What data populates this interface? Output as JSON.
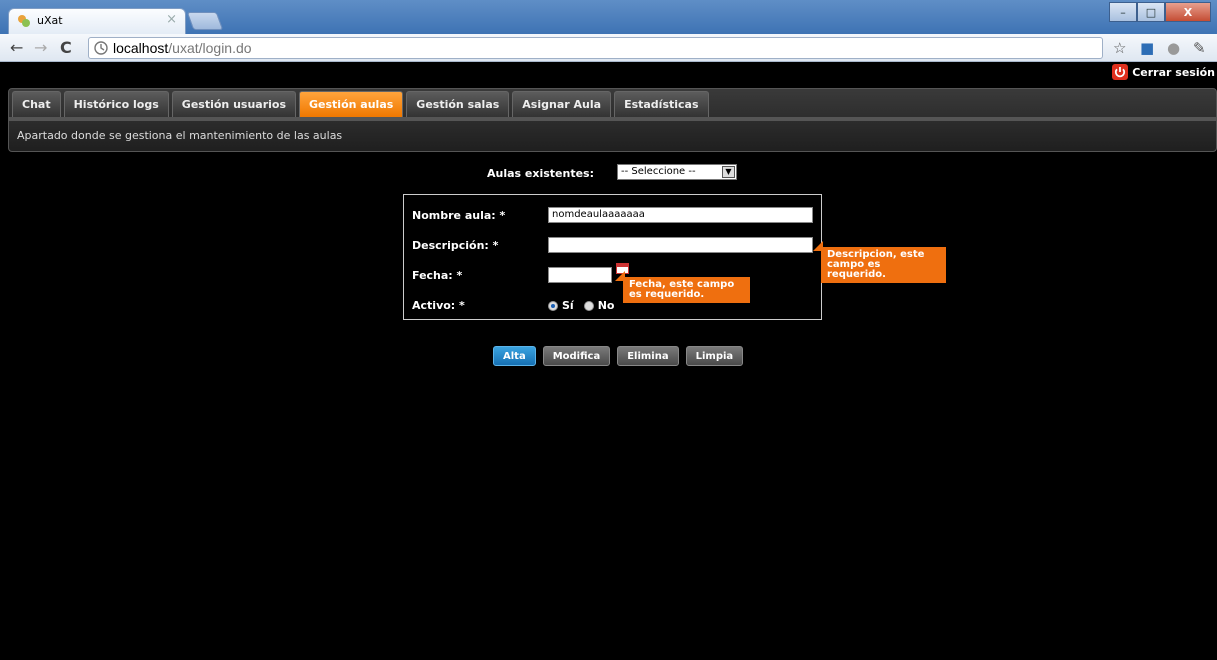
{
  "browser": {
    "tab_title": "uXat",
    "tab_close": "×",
    "url_host": "localhost",
    "url_path": "/uxat/login.do",
    "window_controls": [
      "–",
      "□",
      "X"
    ]
  },
  "header": {
    "logout_label": "Cerrar sesión"
  },
  "menu": {
    "tabs": [
      {
        "label": "Chat"
      },
      {
        "label": "Histórico logs"
      },
      {
        "label": "Gestión usuarios"
      },
      {
        "label": "Gestión aulas"
      },
      {
        "label": "Gestión salas"
      },
      {
        "label": "Asignar Aula"
      },
      {
        "label": "Estadísticas"
      }
    ],
    "active_tab": "Gestión aulas",
    "description": "Apartado donde se gestiona el mantenimiento de las aulas"
  },
  "form": {
    "existing_label": "Aulas existentes:",
    "existing_selected": "-- Seleccione --",
    "nombre_label": "Nombre aula: *",
    "nombre_value": "nomdeaulaaaaaaa",
    "descripcion_label": "Descripción: *",
    "descripcion_value": "",
    "fecha_label": "Fecha: *",
    "fecha_value": "",
    "activo_label": "Activo: *",
    "radio_si": "Sí",
    "radio_no": "No",
    "activo_selected": "Sí",
    "descripcion_error": "Descripcion, este campo es requerido.",
    "fecha_error": "Fecha, este campo es requerido."
  },
  "actions": {
    "alta": "Alta",
    "modifica": "Modifica",
    "elimina": "Elimina",
    "limpia": "Limpia"
  },
  "colors": {
    "accent": "#f07800",
    "error_tip": "#ef6f0f",
    "primary_button": "#1670b3"
  }
}
